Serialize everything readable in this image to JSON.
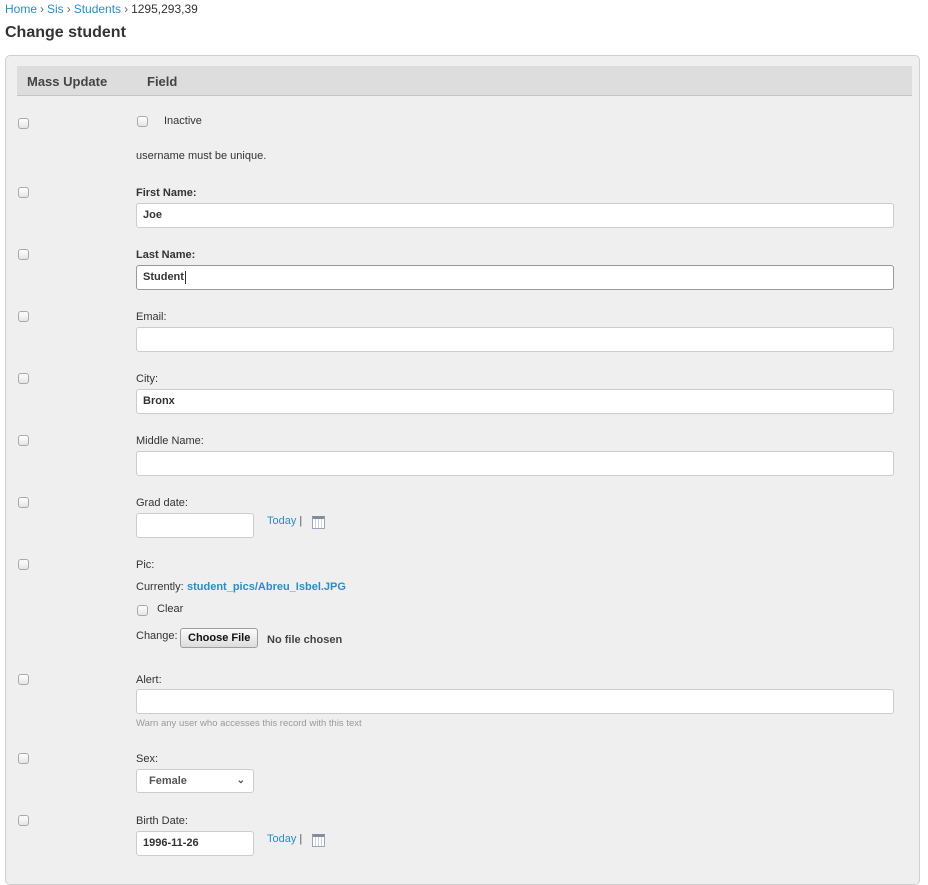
{
  "breadcrumb": {
    "home": "Home",
    "app": "Sis",
    "model": "Students",
    "current": "1295,293,39"
  },
  "page": {
    "title": "Change student"
  },
  "table": {
    "col_mass_update": "Mass Update",
    "col_field": "Field"
  },
  "fields": {
    "inactive": {
      "label": "Inactive",
      "checked": false
    },
    "username_note": "username must be unique.",
    "first_name": {
      "label": "First Name:",
      "value": "Joe"
    },
    "last_name": {
      "label": "Last Name:",
      "value": "Student"
    },
    "email": {
      "label": "Email:",
      "value": ""
    },
    "city": {
      "label": "City:",
      "value": "Bronx"
    },
    "middle_name": {
      "label": "Middle Name:",
      "value": ""
    },
    "grad_date": {
      "label": "Grad date:",
      "value": "",
      "today": "Today",
      "sep": "|"
    },
    "pic": {
      "label": "Pic:",
      "currently_label": "Currently:",
      "current_file": "student_pics/Abreu_Isbel.JPG",
      "clear_label": "Clear",
      "change_label": "Change:",
      "choose_button": "Choose File",
      "no_file": "No file chosen"
    },
    "alert": {
      "label": "Alert:",
      "value": "",
      "help": "Warn any user who accesses this record with this text"
    },
    "sex": {
      "label": "Sex:",
      "selected": "Female"
    },
    "birth_date": {
      "label": "Birth Date:",
      "value": "1996-11-26",
      "today": "Today",
      "sep": "|"
    }
  },
  "icons": {
    "calendar": "calendar-icon",
    "dropdown": "chevron-down-icon"
  },
  "colors": {
    "link": "#2b8dc4",
    "panel_bg": "#efefef",
    "header_bg": "#dddddd"
  }
}
